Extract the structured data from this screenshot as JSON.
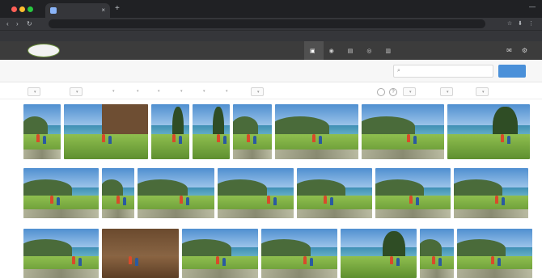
{
  "browser": {
    "tab_title": "",
    "tab_close": "×",
    "new_tab": "+",
    "window_controls": "—",
    "nav": {
      "back": "‹",
      "forward": "›",
      "reload": "↻"
    },
    "address": "",
    "toolbar_icons": [
      "☆",
      "⬇",
      "⋮"
    ],
    "bookmarks": []
  },
  "app": {
    "logo_text": "",
    "nav": [
      {
        "label": "",
        "icon": "▣",
        "active": true
      },
      {
        "label": "",
        "icon": "◉",
        "active": false
      },
      {
        "label": "",
        "icon": "▤",
        "active": false
      },
      {
        "label": "",
        "icon": "◎",
        "active": false
      },
      {
        "label": "",
        "icon": "▥",
        "active": false
      }
    ],
    "right_icons": [
      "✉",
      "⚙"
    ]
  },
  "page": {
    "title": "",
    "title_search": "",
    "search_placeholder": "",
    "search_button": ""
  },
  "filters": {
    "chips_left": [
      {
        "label": ""
      },
      {
        "label": ""
      }
    ],
    "mid_filters": [
      "",
      "",
      "",
      "",
      "",
      ""
    ],
    "date_filter": "",
    "help": "?",
    "chips_right": [
      {
        "label": ""
      },
      {
        "label": ""
      },
      {
        "label": ""
      }
    ]
  },
  "colors": {
    "chrome_bg": "#202124",
    "app_header": "#3c3c3c",
    "accent": "#4a90d9"
  },
  "thumbnails": [
    {
      "row": 0,
      "variant": "lake"
    },
    {
      "row": 0,
      "variant": "hut"
    },
    {
      "row": 0,
      "variant": "tree"
    },
    {
      "row": 0,
      "variant": "tree"
    },
    {
      "row": 0,
      "variant": "lake"
    },
    {
      "row": 0,
      "variant": "lake"
    },
    {
      "row": 0,
      "variant": "meadow"
    },
    {
      "row": 0,
      "variant": "tree"
    },
    {
      "row": 1,
      "variant": "meadow"
    },
    {
      "row": 1,
      "variant": "lake"
    },
    {
      "row": 1,
      "variant": "lake"
    },
    {
      "row": 1,
      "variant": "lake"
    },
    {
      "row": 1,
      "variant": "meadow"
    },
    {
      "row": 1,
      "variant": "meadow"
    },
    {
      "row": 1,
      "variant": "meadow"
    },
    {
      "row": 2,
      "variant": "lake"
    },
    {
      "row": 2,
      "variant": "interior"
    },
    {
      "row": 2,
      "variant": "meadow"
    },
    {
      "row": 2,
      "variant": "meadow"
    },
    {
      "row": 2,
      "variant": "tree"
    },
    {
      "row": 2,
      "variant": "meadow"
    },
    {
      "row": 2,
      "variant": "meadow"
    }
  ]
}
